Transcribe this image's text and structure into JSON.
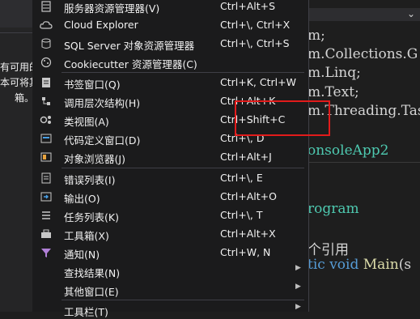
{
  "left_panel": {
    "note_line1": "有可用的",
    "note_line2": "本可将其",
    "note_line3": "箱。"
  },
  "editor": {
    "lines": [
      {
        "text": "m;"
      },
      {
        "text": "m.Collections.G"
      },
      {
        "text": "m.Linq;"
      },
      {
        "text": "m.Text;"
      },
      {
        "text": "m.Threading.Tas"
      },
      {
        "text": "onsoleApp2"
      },
      {
        "text": "rogram"
      },
      {
        "text": "个引用"
      },
      {
        "text_kw": "tic void ",
        "text_fn": "Main",
        "text_rest": "(s"
      }
    ]
  },
  "menu": {
    "items": [
      {
        "label": "服务器资源管理器(V)",
        "shortcut": "Ctrl+Alt+S",
        "icon": "server-explorer-icon"
      },
      {
        "label": "Cloud Explorer",
        "shortcut": "Ctrl+\\, Ctrl+X",
        "icon": "cloud-icon"
      },
      {
        "label": "SQL Server 对象资源管理器",
        "shortcut": "Ctrl+\\, Ctrl+S",
        "icon": "sql-server-icon"
      },
      {
        "label": "Cookiecutter 资源管理器(C)",
        "shortcut": "",
        "icon": "cookie-icon"
      },
      {
        "label": "书签窗口(Q)",
        "shortcut": "Ctrl+K, Ctrl+W",
        "icon": "bookmark-icon"
      },
      {
        "label": "调用层次结构(H)",
        "shortcut": "Ctrl+Alt+K",
        "icon": "call-hierarchy-icon"
      },
      {
        "label": "类视图(A)",
        "shortcut": "Ctrl+Shift+C",
        "icon": "class-view-icon"
      },
      {
        "label": "代码定义窗口(D)",
        "shortcut": "Ctrl+\\, D",
        "icon": "code-definition-icon"
      },
      {
        "label": "对象浏览器(J)",
        "shortcut": "Ctrl+Alt+J",
        "icon": "object-browser-icon"
      },
      {
        "label": "错误列表(I)",
        "shortcut": "Ctrl+\\, E",
        "icon": "error-list-icon"
      },
      {
        "label": "输出(O)",
        "shortcut": "Ctrl+Alt+O",
        "icon": "output-icon"
      },
      {
        "label": "任务列表(K)",
        "shortcut": "Ctrl+\\, T",
        "icon": "task-list-icon"
      },
      {
        "label": "工具箱(X)",
        "shortcut": "Ctrl+Alt+X",
        "icon": "toolbox-icon"
      },
      {
        "label": "通知(N)",
        "shortcut": "Ctrl+W, N",
        "icon": "notification-icon"
      },
      {
        "label": "查找结果(N)",
        "shortcut": "",
        "icon": "",
        "submenu": true
      },
      {
        "label": "其他窗口(E)",
        "shortcut": "",
        "icon": "",
        "submenu": true
      },
      {
        "label": "工具栏(T)",
        "shortcut": "",
        "icon": "",
        "submenu": true
      }
    ]
  },
  "highlight": {
    "color": "#e21b1b",
    "target": "Ctrl+Shift+C"
  }
}
